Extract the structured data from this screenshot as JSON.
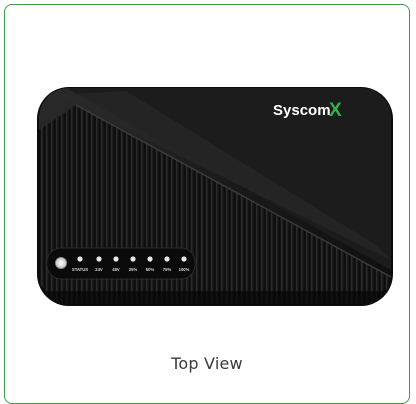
{
  "card": {
    "border_color": "#3f9a4a",
    "caption": "Top View"
  },
  "device": {
    "brand_text": "Syscom",
    "brand_mark": "X",
    "brand_mark_color": "#2fb34a",
    "body_color": "#151515",
    "led_labels": [
      "STATUS",
      "24V",
      "48V",
      "25%",
      "50%",
      "75%",
      "100%"
    ]
  }
}
